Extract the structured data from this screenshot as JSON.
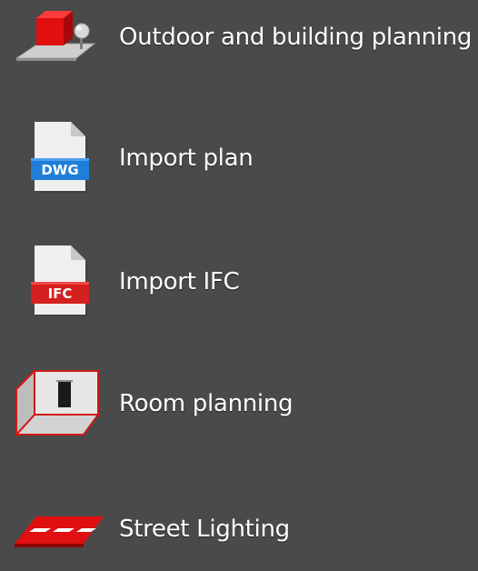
{
  "menu": {
    "items": [
      {
        "label": "Outdoor and building planning",
        "icon": "outdoor-building-icon"
      },
      {
        "label": "Import plan",
        "icon": "dwg-file-icon",
        "badge": "DWG",
        "badge_color": "#1f7fd8"
      },
      {
        "label": "Import IFC",
        "icon": "ifc-file-icon",
        "badge": "IFC",
        "badge_color": "#d42020"
      },
      {
        "label": "Room planning",
        "icon": "room-icon"
      },
      {
        "label": "Street Lighting",
        "icon": "street-icon"
      }
    ]
  },
  "colors": {
    "background": "#4a4a4a",
    "accent_red": "#e01010",
    "dwg_blue": "#1f7fd8",
    "ifc_red": "#d42020"
  }
}
